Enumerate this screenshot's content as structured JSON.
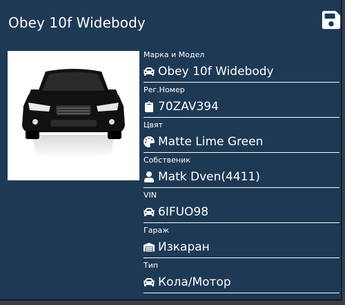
{
  "vehicle": {
    "title": "Obey 10f Widebody"
  },
  "fields": [
    {
      "label": "Марка и Модел",
      "value": "Obey 10f Widebody",
      "icon": "car-icon"
    },
    {
      "label": "Рег.Номер",
      "value": "70ZAV394",
      "icon": "clipboard-icon"
    },
    {
      "label": "Цвят",
      "value": "Matte Lime Green",
      "icon": "palette-icon"
    },
    {
      "label": "Собственик",
      "value": "Matk Dven(4411)",
      "icon": "user-icon"
    },
    {
      "label": "VIN",
      "value": "6IFUO98",
      "icon": "car-icon"
    },
    {
      "label": "Гараж",
      "value": "Изкаран",
      "icon": "warehouse-icon"
    },
    {
      "label": "Тип",
      "value": "Кола/Мотор",
      "icon": "car-icon"
    }
  ],
  "colors": {
    "panel": "#1e3954",
    "text": "#ffffff"
  }
}
